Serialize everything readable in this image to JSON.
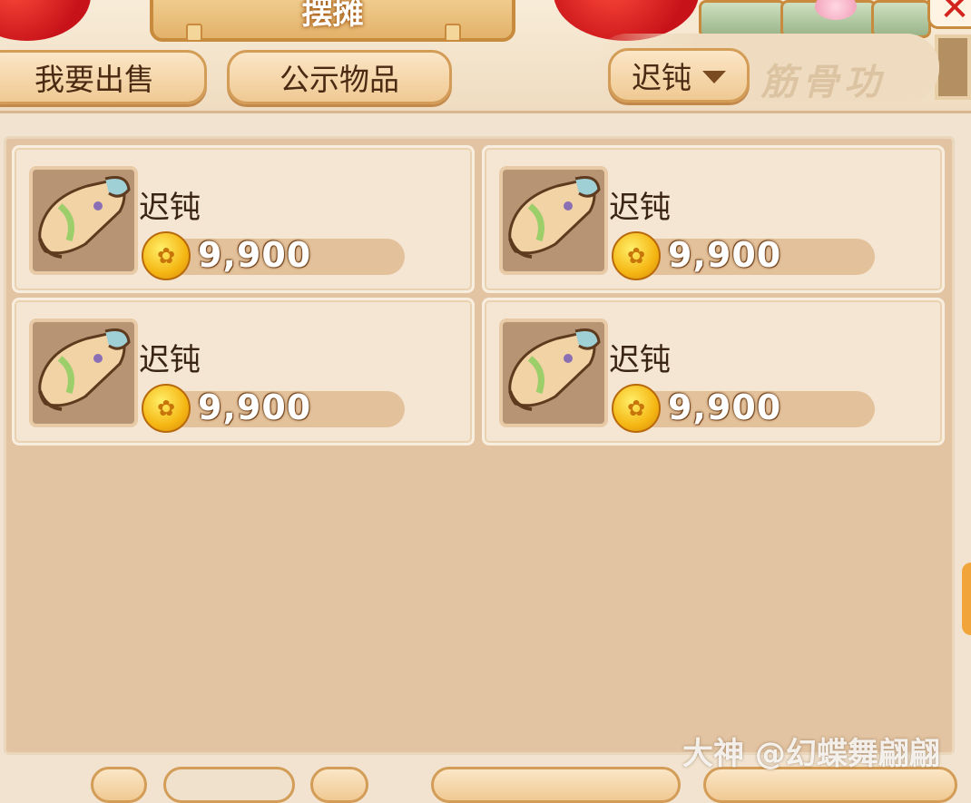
{
  "header": {
    "title": "摆摊"
  },
  "tabs": [
    {
      "label": "我要出售"
    },
    {
      "label": "公示物品"
    }
  ],
  "filter": {
    "selected": "迟钝",
    "decor_text": "筋骨功"
  },
  "listings": [
    {
      "name": "迟钝",
      "price": "9,900"
    },
    {
      "name": "迟钝",
      "price": "9,900"
    },
    {
      "name": "迟钝",
      "price": "9,900"
    },
    {
      "name": "迟钝",
      "price": "9,900"
    }
  ],
  "watermark": "大神 @幻蝶舞翩翩",
  "icons": {
    "item": "scroll-icon",
    "currency": "gold-coin-icon",
    "close": "close-icon",
    "dropdown": "triangle-down-icon"
  },
  "colors": {
    "panel_bg": "#e2c4a2",
    "card_bg": "#f4e6d3",
    "tab_border": "#d39c57",
    "close_red": "#d2231d"
  }
}
